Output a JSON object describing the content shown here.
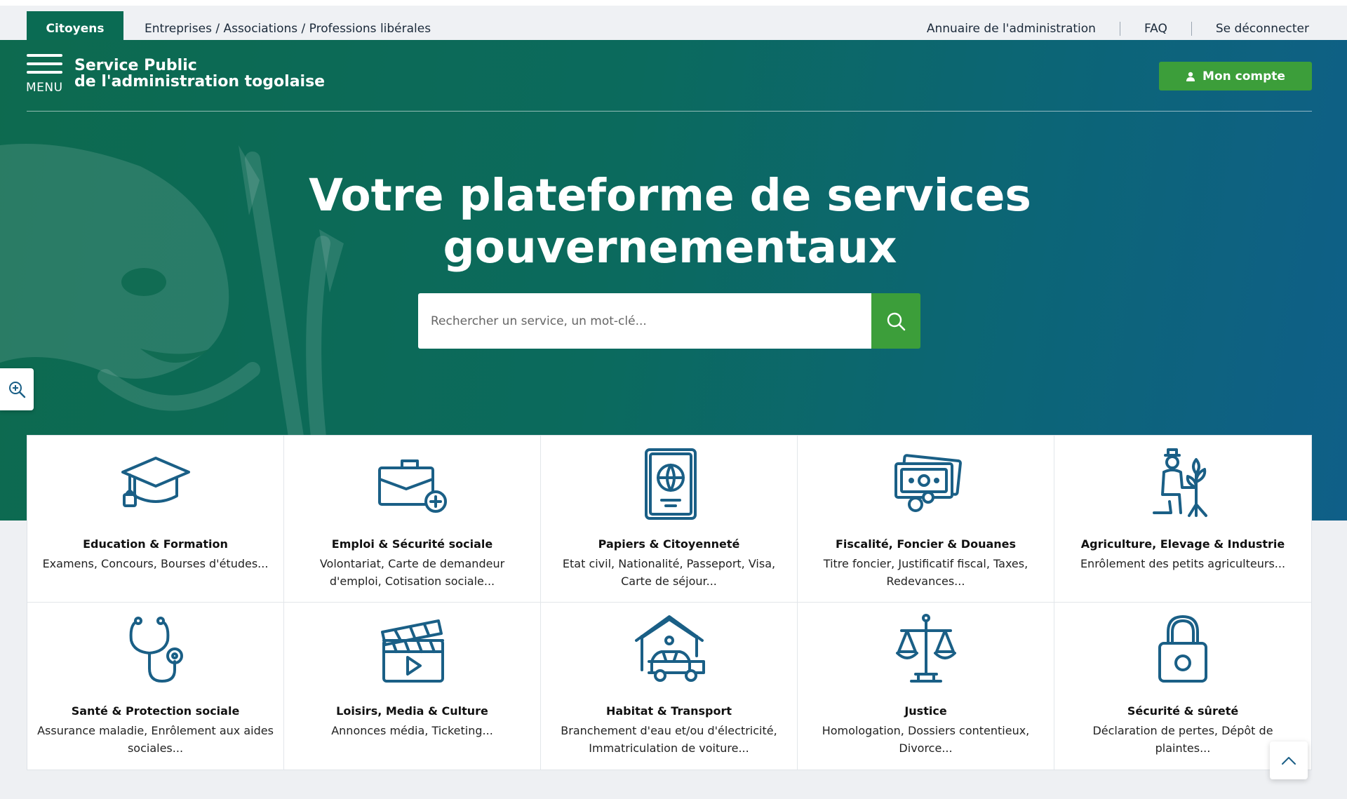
{
  "topbar": {
    "active_tab": "Citoyens",
    "other_tab": "Entreprises / Associations / Professions libérales",
    "links": [
      "Annuaire de l'administration",
      "FAQ",
      "Se déconnecter"
    ]
  },
  "header": {
    "menu_label": "MENU",
    "brand_line1": "Service Public",
    "brand_line2": "de l'administration togolaise",
    "account_label": "Mon compte"
  },
  "hero": {
    "title_line1": "Votre plateforme de services",
    "title_line2": "gouvernementaux",
    "search_placeholder": "Rechercher un service, un mot-clé..."
  },
  "categories": [
    {
      "title": "Education & Formation",
      "desc": "Examens, Concours, Bourses d'études...",
      "icon": "graduation-cap-icon"
    },
    {
      "title": "Emploi & Sécurité sociale",
      "desc": "Volontariat, Carte de demandeur d'emploi, Cotisation sociale...",
      "icon": "briefcase-icon"
    },
    {
      "title": "Papiers & Citoyenneté",
      "desc": "Etat civil, Nationalité, Passeport, Visa, Carte de séjour...",
      "icon": "passport-icon"
    },
    {
      "title": "Fiscalité, Foncier & Douanes",
      "desc": "Titre foncier, Justificatif fiscal, Taxes, Redevances...",
      "icon": "money-icon"
    },
    {
      "title": "Agriculture, Elevage & Industrie",
      "desc": "Enrôlement des petits agriculteurs...",
      "icon": "farmer-icon"
    },
    {
      "title": "Santé & Protection sociale",
      "desc": "Assurance maladie, Enrôlement aux aides sociales...",
      "icon": "stethoscope-icon"
    },
    {
      "title": "Loisirs, Media & Culture",
      "desc": "Annonces média, Ticketing...",
      "icon": "clapperboard-icon"
    },
    {
      "title": "Habitat & Transport",
      "desc": "Branchement d'eau et/ou d'électricité, Immatriculation de voiture...",
      "icon": "house-car-icon"
    },
    {
      "title": "Justice",
      "desc": "Homologation, Dossiers contentieux, Divorce...",
      "icon": "scales-icon"
    },
    {
      "title": "Sécurité & sûreté",
      "desc": "Déclaration de pertes, Dépôt de plaintes...",
      "icon": "padlock-icon"
    }
  ],
  "colors": {
    "brand_green": "#0a6b53",
    "accent_green": "#3c9e3a",
    "icon_blue": "#1a5f86"
  }
}
